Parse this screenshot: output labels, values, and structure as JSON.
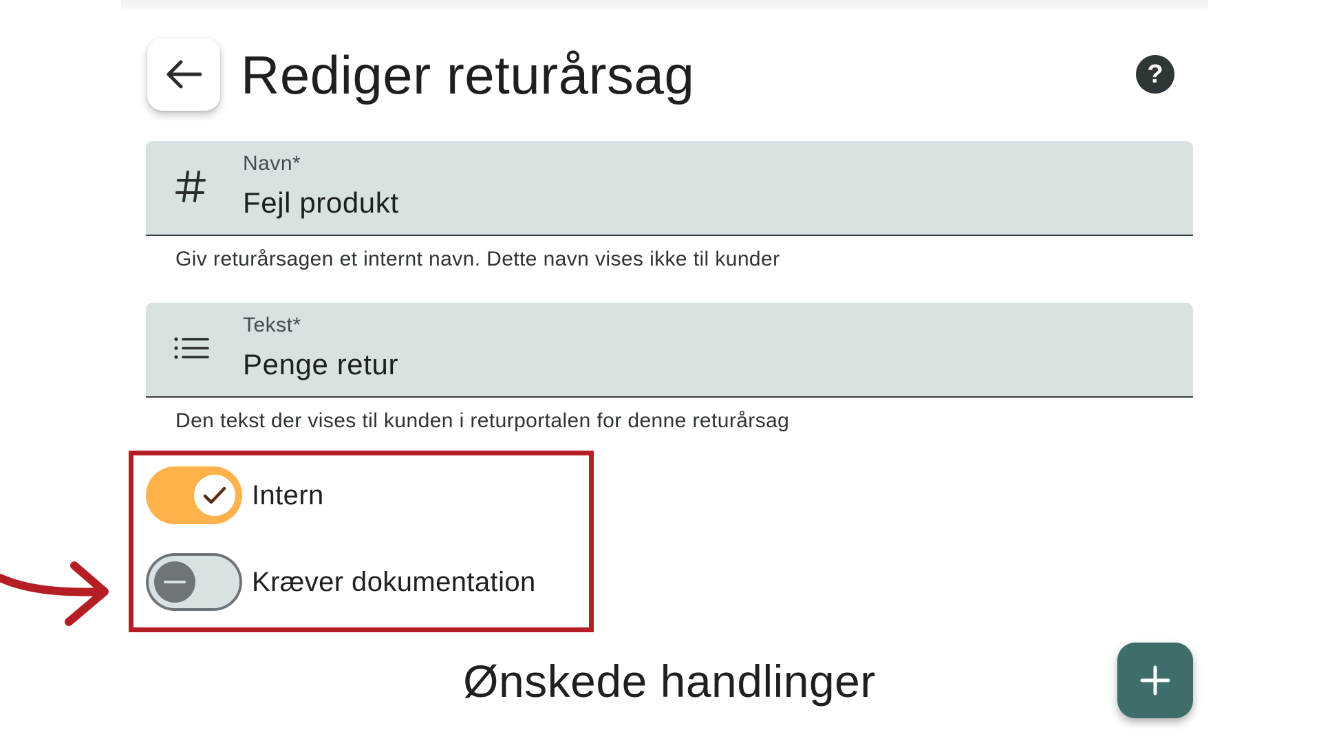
{
  "header": {
    "title": "Rediger returårsag",
    "back_icon": "arrow-left-icon",
    "help_label": "?"
  },
  "fields": {
    "navn": {
      "label": "Navn*",
      "value": "Fejl produkt",
      "hint": "Giv returårsagen et internt navn. Dette navn vises ikke til kunder",
      "icon": "hash-icon"
    },
    "tekst": {
      "label": "Tekst*",
      "value": "Penge retur",
      "hint": "Den tekst der vises til kunden i returportalen for denne returårsag",
      "icon": "list-icon"
    }
  },
  "toggles": {
    "intern": {
      "label": "Intern",
      "checked": true
    },
    "kraever_dokumentation": {
      "label": "Kræver dokumentation",
      "checked": false
    }
  },
  "actions_section": {
    "title": "Ønskede handlinger",
    "add_label": "+"
  },
  "colors": {
    "accent_toggle": "#ffb24c",
    "primary_button": "#3e6e6c",
    "field_background": "#d9e2e3",
    "annotation": "#b51e24"
  }
}
